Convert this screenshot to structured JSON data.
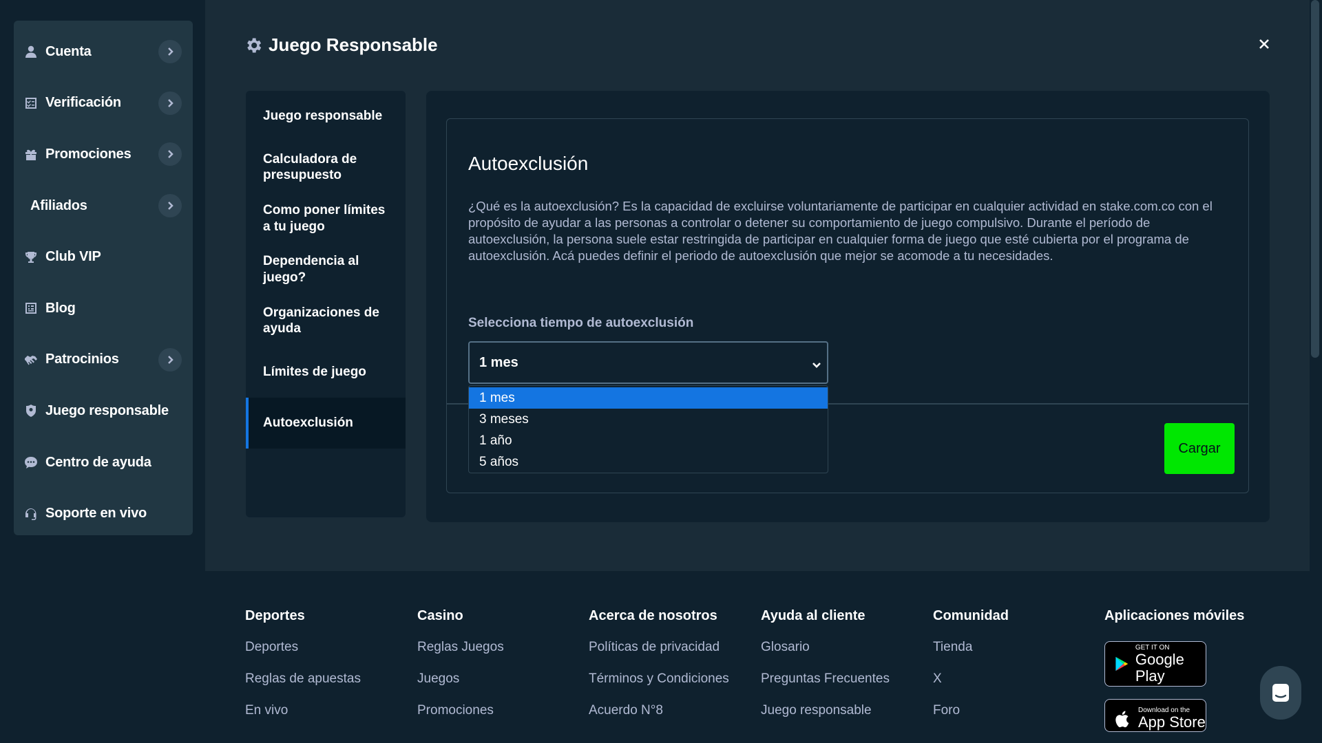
{
  "modal": {
    "title": "Juego Responsable",
    "close_label": "×"
  },
  "sidebar": {
    "items": [
      {
        "label": "Cuenta",
        "icon": "user-icon",
        "has_chevron": true
      },
      {
        "label": "Verificación",
        "icon": "checklist-icon",
        "has_chevron": true
      },
      {
        "label": "Promociones",
        "icon": "gift-icon",
        "has_chevron": true
      },
      {
        "label": "Afiliados",
        "icon": "",
        "has_chevron": true
      },
      {
        "label": "Club VIP",
        "icon": "trophy-icon",
        "has_chevron": false
      },
      {
        "label": "Blog",
        "icon": "blog-icon",
        "has_chevron": false
      },
      {
        "label": "Patrocinios",
        "icon": "handshake-icon",
        "has_chevron": true
      },
      {
        "label": "Juego responsable",
        "icon": "shield-icon",
        "has_chevron": false
      },
      {
        "label": "Centro de ayuda",
        "icon": "chat-bubble-icon",
        "has_chevron": false
      },
      {
        "label": "Soporte en vivo",
        "icon": "headset-icon",
        "has_chevron": false
      }
    ]
  },
  "inner_nav": {
    "items": [
      {
        "label": "Juego responsable"
      },
      {
        "label": "Calculadora de presupuesto"
      },
      {
        "label": "Como poner límites a tu juego"
      },
      {
        "label": "Dependencia al juego?"
      },
      {
        "label": "Organizaciones de ayuda"
      },
      {
        "label": "Límites de juego"
      },
      {
        "label": "Autoexclusión",
        "active": true
      }
    ]
  },
  "panel": {
    "heading": "Autoexclusión",
    "description": "¿Qué es la autoexclusión? Es la capacidad de excluirse voluntariamente de participar en cualquier actividad en stake.com.co con el propósito de ayudar a las personas a controlar o detener su comportamiento de juego compulsivo. Durante el período de autoexclusión, la persona suele estar restringida de participar en cualquier forma de juego que esté cubierta por el programa de autoexclusión. Acá puedes definir el periodo de autoexclusión que mejor se acomode a tu necesidades.",
    "select_label": "Selecciona tiempo de autoexclusión",
    "select_value": "1 mes",
    "options": [
      "1 mes",
      "3 meses",
      "1 año",
      "5 años"
    ],
    "selected_option": "1 mes",
    "submit_label": "Cargar"
  },
  "footer": {
    "columns": [
      {
        "heading": "Deportes",
        "links": [
          "Deportes",
          "Reglas de apuestas",
          "En vivo"
        ]
      },
      {
        "heading": "Casino",
        "links": [
          "Reglas Juegos",
          "Juegos",
          "Promociones"
        ]
      },
      {
        "heading": "Acerca de nosotros",
        "links": [
          "Políticas de privacidad",
          "Términos y Condiciones",
          "Acuerdo N°8"
        ]
      },
      {
        "heading": "Ayuda al cliente",
        "links": [
          "Glosario",
          "Preguntas Frecuentes",
          "Juego responsable"
        ]
      },
      {
        "heading": "Comunidad",
        "links": [
          "Tienda",
          "X",
          "Foro"
        ]
      }
    ],
    "apps": {
      "heading": "Aplicaciones móviles",
      "google_small": "GET IT ON",
      "google_big": "Google Play",
      "apple_small": "Download on the",
      "apple_big": "App Store"
    }
  },
  "colors": {
    "background": "#1a2c38",
    "panel": "#0f212e",
    "card": "#213743",
    "accent_blue": "#1475e1",
    "accent_green": "#00e701",
    "muted_text": "#b1bad3"
  }
}
